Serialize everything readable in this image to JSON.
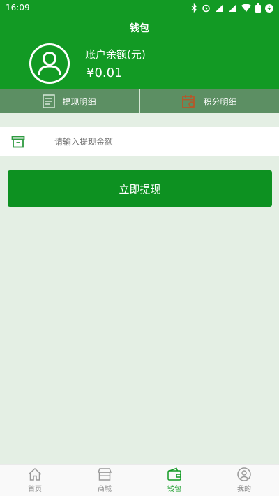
{
  "status_bar": {
    "time": "16:09",
    "icons": [
      "bluetooth-icon",
      "alarm-icon",
      "signal-icon",
      "signal-icon",
      "wifi-icon",
      "battery-icon",
      "charging-icon"
    ]
  },
  "header": {
    "title": "钱包",
    "balance_label": "账户余额(元)",
    "balance_value": "¥0.01"
  },
  "details": {
    "withdraw_detail": "提现明细",
    "points_detail": "积分明细"
  },
  "withdraw_input": {
    "placeholder": "请输入提现金额",
    "value": ""
  },
  "withdraw_button": "立即提现",
  "bottom_nav": {
    "items": [
      {
        "label": "首页",
        "icon": "home-icon",
        "active": false
      },
      {
        "label": "商城",
        "icon": "store-icon",
        "active": false
      },
      {
        "label": "钱包",
        "icon": "wallet-icon",
        "active": true
      },
      {
        "label": "我的",
        "icon": "user-icon",
        "active": false
      }
    ]
  },
  "colors": {
    "primary": "#129a24",
    "detail_bar": "#5c8f63",
    "page_bg": "#e4efe4",
    "points_icon": "#b5582a"
  }
}
